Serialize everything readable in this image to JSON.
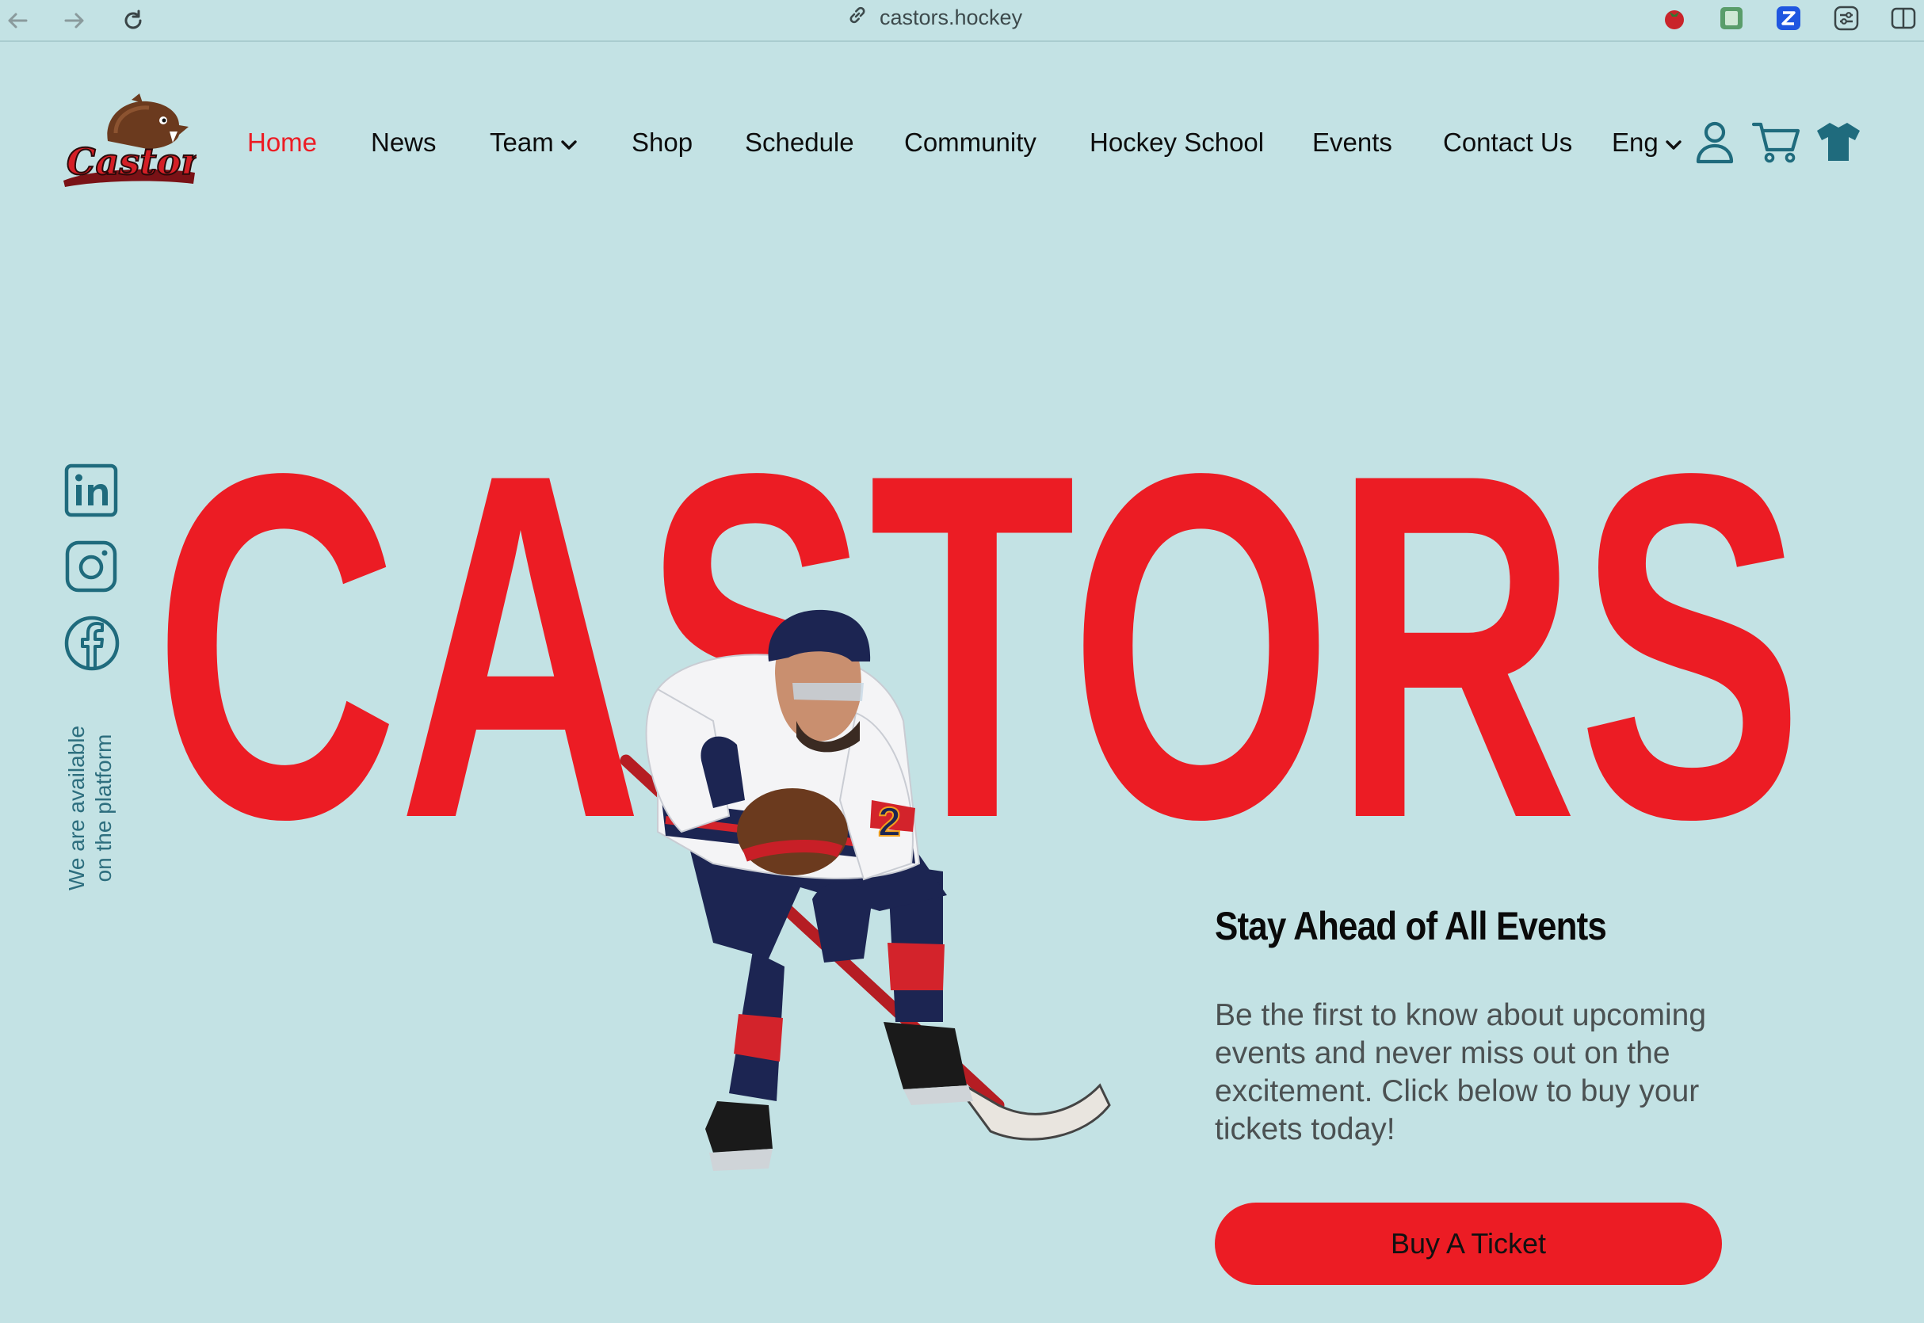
{
  "browser": {
    "url": "castors.hockey",
    "icons": [
      "back-arrow-icon",
      "forward-arrow-icon",
      "reload-icon",
      "link-icon",
      "tomato-extension-icon",
      "green-extension-icon",
      "blue-extension-icon",
      "sliders-extension-icon",
      "sidebar-toggle-icon"
    ]
  },
  "header": {
    "logo_text": "Castors",
    "nav": [
      {
        "label": "Home",
        "active": true
      },
      {
        "label": "News"
      },
      {
        "label": "Team",
        "dropdown": true
      },
      {
        "label": "Shop"
      },
      {
        "label": "Schedule"
      },
      {
        "label": "Community"
      },
      {
        "label": "Hockey School"
      },
      {
        "label": "Events"
      },
      {
        "label": "Contact Us"
      }
    ],
    "language": "Eng",
    "icons": [
      "user-icon",
      "cart-icon",
      "jersey-icon"
    ]
  },
  "social": {
    "icons": [
      "linkedin-icon",
      "instagram-icon",
      "facebook-icon"
    ],
    "note_line1": "We are available",
    "note_line2": "on the platform"
  },
  "hero": {
    "big_word": "CASTORS",
    "player_number": "2"
  },
  "promo": {
    "title": "Stay Ahead of All Events",
    "text": "Be the first to know about upcoming events and never miss out on the excitement. Click below to buy your tickets today!",
    "button": "Buy A Ticket"
  },
  "colors": {
    "background": "#c3e2e4",
    "accent_red": "#ec1c24",
    "icon_teal": "#1f6b7d",
    "text_dark": "#0d0d0d"
  }
}
